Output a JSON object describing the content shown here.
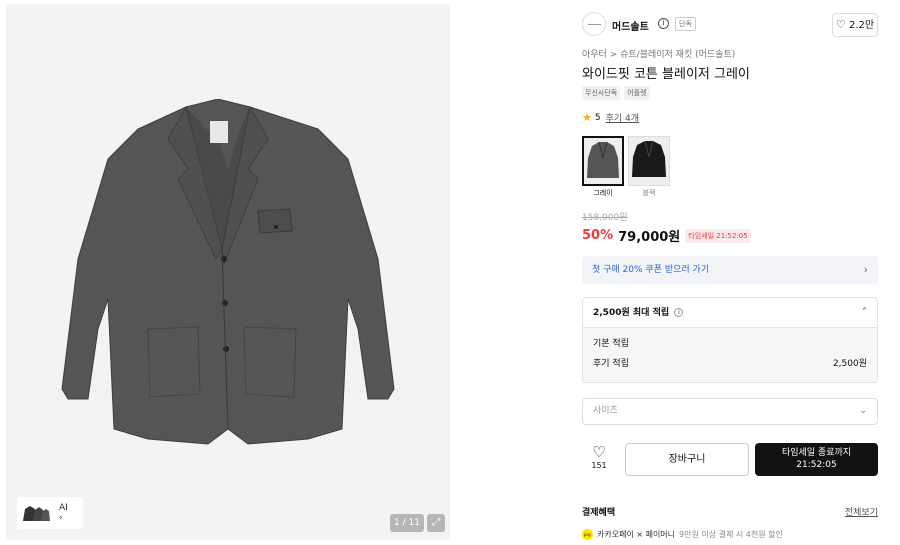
{
  "gallery": {
    "counter": "1 / 11",
    "ai_label": "AI",
    "ai_arrow": "›",
    "expand_icon": "⤢"
  },
  "brand": {
    "name": "머드솔트",
    "info": "i",
    "badge": "단독",
    "likes": "2.2만"
  },
  "breadcrumb": "아우터 > 슈트/블레이저 재킷 (머드솔트)",
  "title": "와이드핏 코튼 블레이저 그레이",
  "tags": [
    "무신사단독",
    "어플렛"
  ],
  "rating": {
    "score": "5",
    "reviews": "후기 4개"
  },
  "swatches": [
    {
      "label": "그레이",
      "selected": true,
      "color": "#555555"
    },
    {
      "label": "블랙",
      "selected": false,
      "color": "#1a1a1a"
    }
  ],
  "price": {
    "original": "158,000원",
    "discount": "50%",
    "current": "79,000원",
    "timesale": "타임세일 21:52:05"
  },
  "coupon": {
    "text": "첫 구매 20% 쿠폰 받으러 가기",
    "chevron": "›"
  },
  "points": {
    "header": "2,500원 최대 적립",
    "info": "i",
    "chevron": "˄",
    "rows": [
      {
        "label": "기본 적립",
        "value": ""
      },
      {
        "label": "후기 적립",
        "value": "2,500원"
      }
    ]
  },
  "size_select": {
    "placeholder": "사이즈",
    "chevron": "⌄"
  },
  "actions": {
    "wish_count": "151",
    "cart": "장바구니",
    "buy_line1": "타임세일 종료까지",
    "buy_line2": "21:52:05"
  },
  "payment": {
    "title": "결제혜택",
    "more": "전체보기",
    "line_main": "카카오페이 × 페이머니",
    "line_dim": "9만원 이상 결제 시 4천원 할인",
    "kakao_icon_text": "pay"
  },
  "colors": {
    "accent_red": "#ee3b3b",
    "coupon_blue": "#2b64d8",
    "kakao_yellow": "#fee500",
    "star": "#f4b400"
  }
}
